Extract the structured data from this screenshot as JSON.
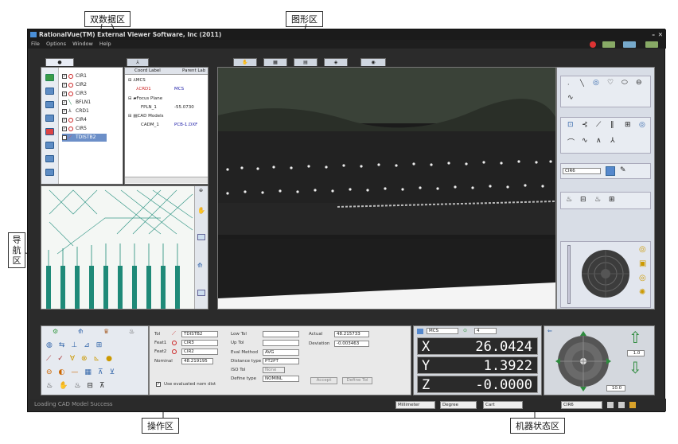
{
  "callouts": {
    "dual_data": "双数据区",
    "graphics": "图形区",
    "nav": "导航区",
    "nav_chars": [
      "导",
      "航",
      "区"
    ],
    "operation": "操作区",
    "machine_status": "机器状态区"
  },
  "window": {
    "title": "RationalVue(TM) External Viewer Software, Inc (2011)",
    "menu": [
      "File",
      "Options",
      "Window",
      "Help"
    ]
  },
  "feature_list": [
    "CIR1",
    "CIR2",
    "CIR3",
    "BFLN1",
    "CRD1",
    "CIR4",
    "CIR5",
    "TDISTB2"
  ],
  "coord_table": {
    "headers": [
      "Coord Label",
      "Parent Lab"
    ],
    "rows": [
      {
        "label": "MCS",
        "parent": ""
      },
      {
        "label": "CRD1",
        "parent": "MCS"
      },
      {
        "label": "Focus Plane",
        "parent": ""
      },
      {
        "label": "FPLN_1",
        "parent": "-55.0730"
      },
      {
        "label": "CAD Models",
        "parent": ""
      },
      {
        "label": "CADM_1",
        "parent": "PCB-1.DXF"
      }
    ]
  },
  "ops": {
    "tol_label": "Tol",
    "tol_value": "TDISTB2",
    "feat1_label": "Feat1",
    "feat1_value": "CIR3",
    "feat2_label": "Feat2",
    "feat2_value": "CIR2",
    "nominal_label": "Nominal",
    "nominal_value": "48.219195",
    "low_tol_label": "Low Tol",
    "up_tol_label": "Up Tol",
    "eval_method_label": "Eval Method",
    "eval_method_value": "AVG",
    "distance_type_label": "Distance type",
    "distance_type_value": "PT2PT",
    "iso_tol_label": "ISO Tol",
    "iso_tol_value": "None",
    "define_type_label": "Define type",
    "define_type_value": "NOMINL",
    "actual_label": "Actual",
    "actual_value": "48.215733",
    "deviation_label": "Deviation",
    "deviation_value": "-0.003463",
    "use_eval_label": "Use evaluated nom dist",
    "accept_label": "Accept",
    "define_tol_label": "Define Tol"
  },
  "dro": {
    "coord": "MCS",
    "coord_num": "4",
    "x_label": "X",
    "x_value": "26.0424",
    "y_label": "Y",
    "y_value": "1.3922",
    "z_label": "Z",
    "z_value": "-0.0000"
  },
  "jog": {
    "speed1": "1.0",
    "speed2": "10.0"
  },
  "status": {
    "message": "Loading CAD Model Success",
    "units": "Millimeter",
    "angle": "Degree",
    "coords": "Cart",
    "cir": "CIR6"
  },
  "right_panel": {
    "feature_name": "CIR6"
  }
}
